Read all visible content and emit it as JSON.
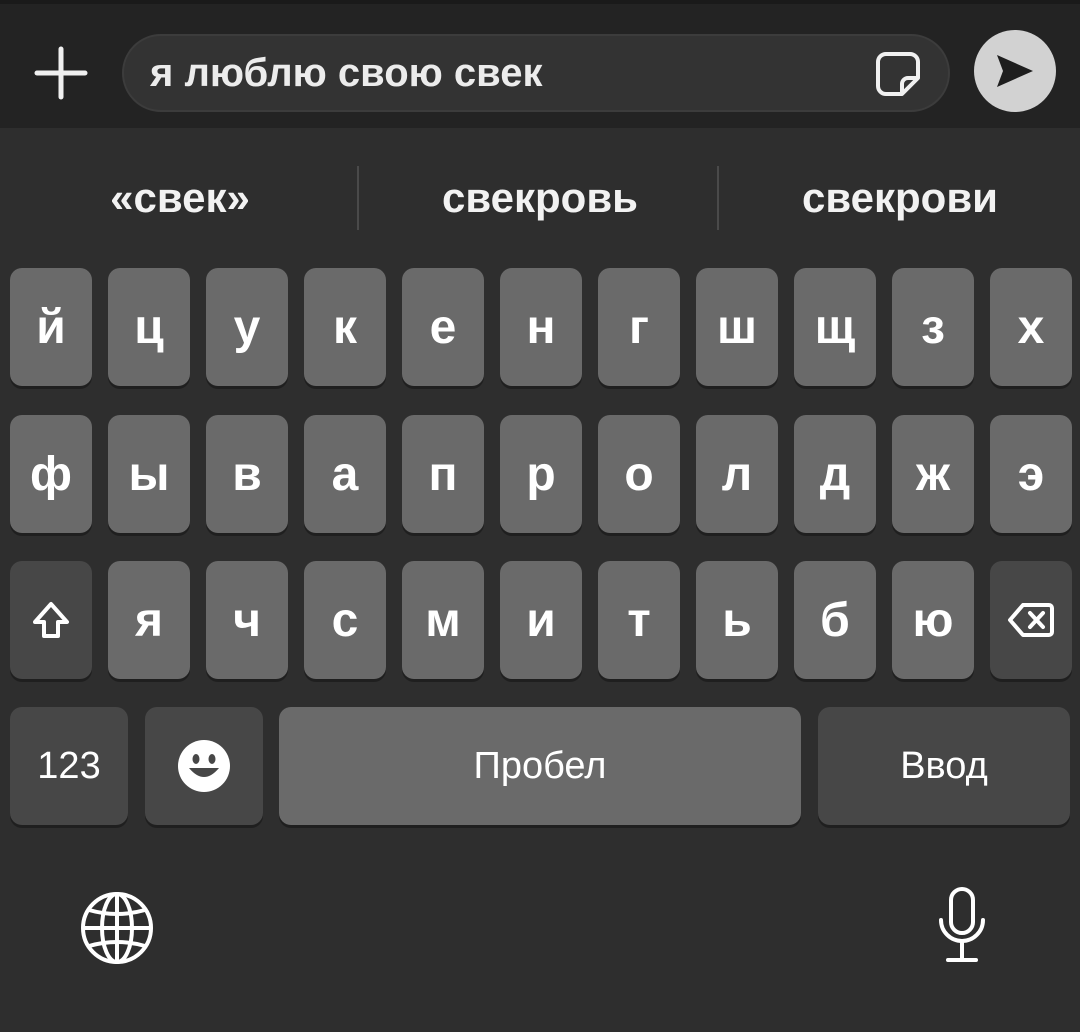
{
  "compose": {
    "message_text": "я люблю свою свек",
    "plus_icon": "plus-icon",
    "sticker_icon": "sticker-icon",
    "send_icon": "send-icon"
  },
  "suggestions": [
    "«свек»",
    "свекровь",
    "свекрови"
  ],
  "keyboard": {
    "row1": [
      "й",
      "ц",
      "у",
      "к",
      "е",
      "н",
      "г",
      "ш",
      "щ",
      "з",
      "х"
    ],
    "row2": [
      "ф",
      "ы",
      "в",
      "а",
      "п",
      "р",
      "о",
      "л",
      "д",
      "ж",
      "э"
    ],
    "row3": [
      "я",
      "ч",
      "с",
      "м",
      "и",
      "т",
      "ь",
      "б",
      "ю"
    ],
    "numbers_label": "123",
    "space_label": "Пробел",
    "enter_label": "Ввод",
    "shift_icon": "shift-icon",
    "backspace_icon": "backspace-icon",
    "emoji_icon": "emoji-icon",
    "globe_icon": "globe-icon",
    "mic_icon": "microphone-icon"
  },
  "colors": {
    "background": "#2e2e2e",
    "key": "#6a6a6a",
    "key_dark": "#474747",
    "send_button": "#d2d2d2"
  }
}
